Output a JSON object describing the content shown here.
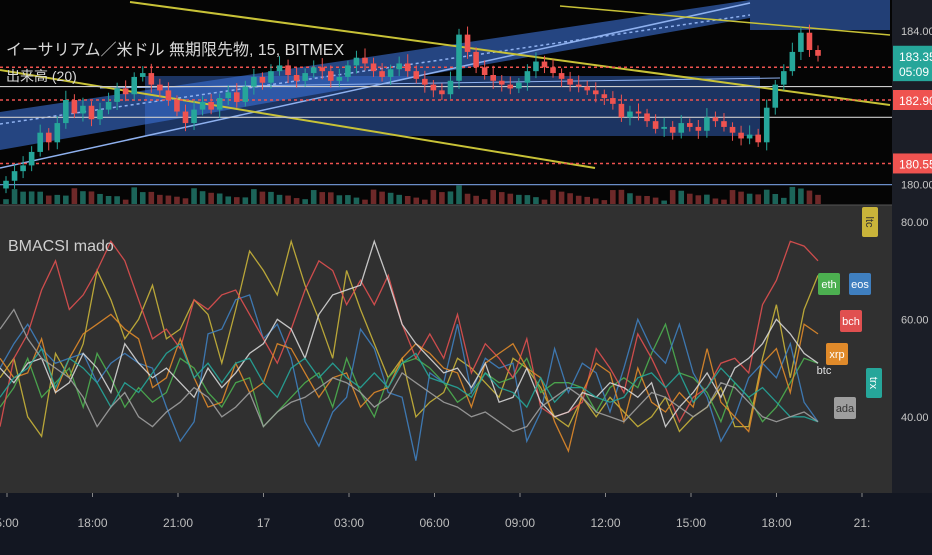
{
  "header": {
    "symbol_title": "イーサリアム／米ドル 無期限先物, 15, BITMEX",
    "volume_label": "出来高 (20)",
    "indicator_label": "BMACSI mado"
  },
  "chart_data": [
    {
      "type": "candlestick",
      "name": "price",
      "ylim": [
        179.6,
        184.8
      ],
      "y_ticks": [
        "184.00",
        "180.00"
      ],
      "price_tags": [
        {
          "label": "183.35",
          "value": 183.35,
          "color": "#26a69a"
        },
        {
          "label": "05:09",
          "value": 182.95,
          "color": "#26a69a"
        },
        {
          "label": "182.90",
          "value": 182.2,
          "color": "#ef5350"
        },
        {
          "label": "180.55",
          "value": 180.55,
          "color": "#ef5350"
        }
      ],
      "horizontal_levels": [
        {
          "value": 183.05,
          "style": "dashed",
          "color": "#ef5350"
        },
        {
          "value": 182.55,
          "style": "solid",
          "color": "#cccccc"
        },
        {
          "value": 182.2,
          "style": "dashed",
          "color": "#ef5350"
        },
        {
          "value": 181.75,
          "style": "solid",
          "color": "#cccccc"
        },
        {
          "value": 180.55,
          "style": "dashed",
          "color": "#ef5350"
        },
        {
          "value": 180.0,
          "style": "solid",
          "color": "#6a8dc8"
        }
      ],
      "closes": [
        180.1,
        180.35,
        180.5,
        180.85,
        181.35,
        181.1,
        181.6,
        182.2,
        181.85,
        182.05,
        181.7,
        181.95,
        182.15,
        182.5,
        182.35,
        182.8,
        182.9,
        182.6,
        182.45,
        182.2,
        181.9,
        181.6,
        181.95,
        182.15,
        181.95,
        182.25,
        182.4,
        182.15,
        182.55,
        182.8,
        182.65,
        182.95,
        183.1,
        182.85,
        182.7,
        182.9,
        183.05,
        182.95,
        182.7,
        182.8,
        183.1,
        183.3,
        183.15,
        182.95,
        182.8,
        183.0,
        183.15,
        182.95,
        182.75,
        182.6,
        182.45,
        182.35,
        182.7,
        183.9,
        183.45,
        183.05,
        182.85,
        182.7,
        182.6,
        182.5,
        182.65,
        182.95,
        183.2,
        183.05,
        182.9,
        182.75,
        182.6,
        182.55,
        182.45,
        182.35,
        182.25,
        182.1,
        181.75,
        181.9,
        181.85,
        181.65,
        181.45,
        181.5,
        181.35,
        181.6,
        181.5,
        181.4,
        181.75,
        181.65,
        181.5,
        181.35,
        181.2,
        181.3,
        181.1,
        182.0,
        182.6,
        182.95,
        183.45,
        183.95,
        183.5,
        183.35
      ]
    },
    {
      "type": "line",
      "name": "BMACSI mado",
      "ylim": [
        25,
        82
      ],
      "y_ticks": [
        "80.00",
        "60.00",
        "40.00"
      ],
      "x_tick_labels": [
        "5:00",
        "18:00",
        "21:00",
        "17",
        "03:00",
        "06:00",
        "09:00",
        "12:00",
        "15:00",
        "18:00",
        "21:"
      ],
      "series": [
        {
          "name": "ltc",
          "color": "#c9b43a",
          "values": [
            48,
            52,
            40,
            36,
            53,
            48,
            55,
            70,
            64,
            56,
            60,
            67,
            56,
            58,
            64,
            61,
            51,
            62,
            74,
            70,
            65,
            76,
            67,
            60,
            52,
            70,
            62,
            55,
            48,
            52,
            40,
            43,
            45,
            52,
            50,
            47,
            44,
            52,
            50,
            46,
            40,
            38,
            44,
            40,
            44,
            41,
            38,
            40,
            44,
            37,
            40,
            42,
            46,
            38,
            38,
            52,
            63,
            48,
            62,
            69
          ]
        },
        {
          "name": "eth",
          "color": "#4caf50",
          "values": [
            42,
            46,
            52,
            44,
            47,
            50,
            42,
            53,
            48,
            42,
            46,
            43,
            45,
            52,
            50,
            45,
            42,
            47,
            48,
            38,
            41,
            44,
            47,
            49,
            42,
            52,
            45,
            40,
            48,
            51,
            52,
            50,
            47,
            43,
            45,
            49,
            47,
            48,
            52,
            45,
            47,
            47,
            46,
            41,
            46,
            48,
            46,
            53,
            59,
            49,
            48,
            45,
            39,
            47,
            44,
            39,
            42,
            47,
            52,
            51
          ]
        },
        {
          "name": "eos",
          "color": "#3f7fbf",
          "values": [
            50,
            55,
            59,
            54,
            51,
            52,
            53,
            47,
            51,
            53,
            51,
            50,
            42,
            35,
            39,
            57,
            58,
            64,
            65,
            56,
            59,
            52,
            39,
            34,
            41,
            44,
            58,
            54,
            45,
            44,
            31,
            49,
            47,
            59,
            45,
            52,
            50,
            51,
            35,
            41,
            54,
            45,
            51,
            49,
            41,
            50,
            60,
            54,
            51,
            59,
            49,
            44,
            35,
            40,
            48,
            51,
            48,
            55,
            43,
            39
          ]
        },
        {
          "name": "bch",
          "color": "#e05050",
          "values": [
            38,
            52,
            57,
            66,
            72,
            62,
            65,
            70,
            76,
            72,
            64,
            56,
            58,
            54,
            64,
            62,
            65,
            66,
            61,
            56,
            51,
            58,
            66,
            72,
            70,
            63,
            68,
            63,
            69,
            59,
            52,
            57,
            52,
            61,
            49,
            55,
            52,
            48,
            56,
            42,
            40,
            41,
            43,
            54,
            50,
            45,
            57,
            52,
            46,
            39,
            44,
            46,
            51,
            52,
            49,
            63,
            68,
            76,
            75,
            72
          ]
        },
        {
          "name": "xrp",
          "color": "#e08a2a",
          "values": [
            52,
            48,
            49,
            56,
            45,
            52,
            57,
            59,
            61,
            58,
            56,
            46,
            48,
            56,
            48,
            42,
            43,
            51,
            45,
            47,
            55,
            54,
            49,
            44,
            48,
            49,
            42,
            45,
            46,
            52,
            55,
            53,
            50,
            49,
            42,
            51,
            53,
            55,
            50,
            48,
            39,
            33,
            45,
            51,
            49,
            39,
            50,
            43,
            41,
            45,
            42,
            54,
            43,
            40,
            37,
            51,
            54,
            45,
            59,
            57
          ]
        },
        {
          "name": "btc",
          "color": "#d6d6d6",
          "values": [
            50,
            47,
            51,
            52,
            45,
            47,
            53,
            50,
            45,
            55,
            51,
            48,
            50,
            47,
            44,
            50,
            46,
            49,
            53,
            55,
            60,
            58,
            52,
            61,
            65,
            66,
            67,
            76,
            68,
            59,
            55,
            52,
            49,
            50,
            46,
            51,
            43,
            44,
            50,
            43,
            40,
            41,
            45,
            44,
            47,
            46,
            44,
            47,
            38,
            42,
            45,
            49,
            44,
            50,
            52,
            55,
            60,
            57,
            53,
            51
          ]
        },
        {
          "name": "trx",
          "color": "#26a69a",
          "values": [
            44,
            48,
            50,
            54,
            46,
            52,
            50,
            47,
            42,
            47,
            45,
            49,
            53,
            55,
            48,
            51,
            47,
            51,
            52,
            47,
            44,
            50,
            52,
            48,
            51,
            48,
            46,
            49,
            46,
            51,
            53,
            48,
            47,
            46,
            44,
            49,
            46,
            45,
            42,
            48,
            43,
            46,
            46,
            44,
            43,
            44,
            48,
            49,
            46,
            49,
            43,
            46,
            50,
            47,
            44,
            46,
            43,
            40,
            40,
            39
          ]
        },
        {
          "name": "ada",
          "color": "#9e9e9e",
          "values": [
            58,
            62,
            56,
            52,
            50,
            48,
            44,
            38,
            42,
            45,
            40,
            38,
            41,
            43,
            46,
            44,
            40,
            42,
            45,
            38,
            41,
            43,
            44,
            46,
            48,
            47,
            45,
            42,
            44,
            49,
            47,
            45,
            43,
            42,
            40,
            41,
            39,
            37,
            38,
            42,
            44,
            46,
            44,
            41,
            40,
            39,
            42,
            45,
            44,
            42,
            40,
            42,
            47,
            46,
            43,
            40,
            39,
            40,
            41,
            39
          ]
        }
      ]
    }
  ]
}
